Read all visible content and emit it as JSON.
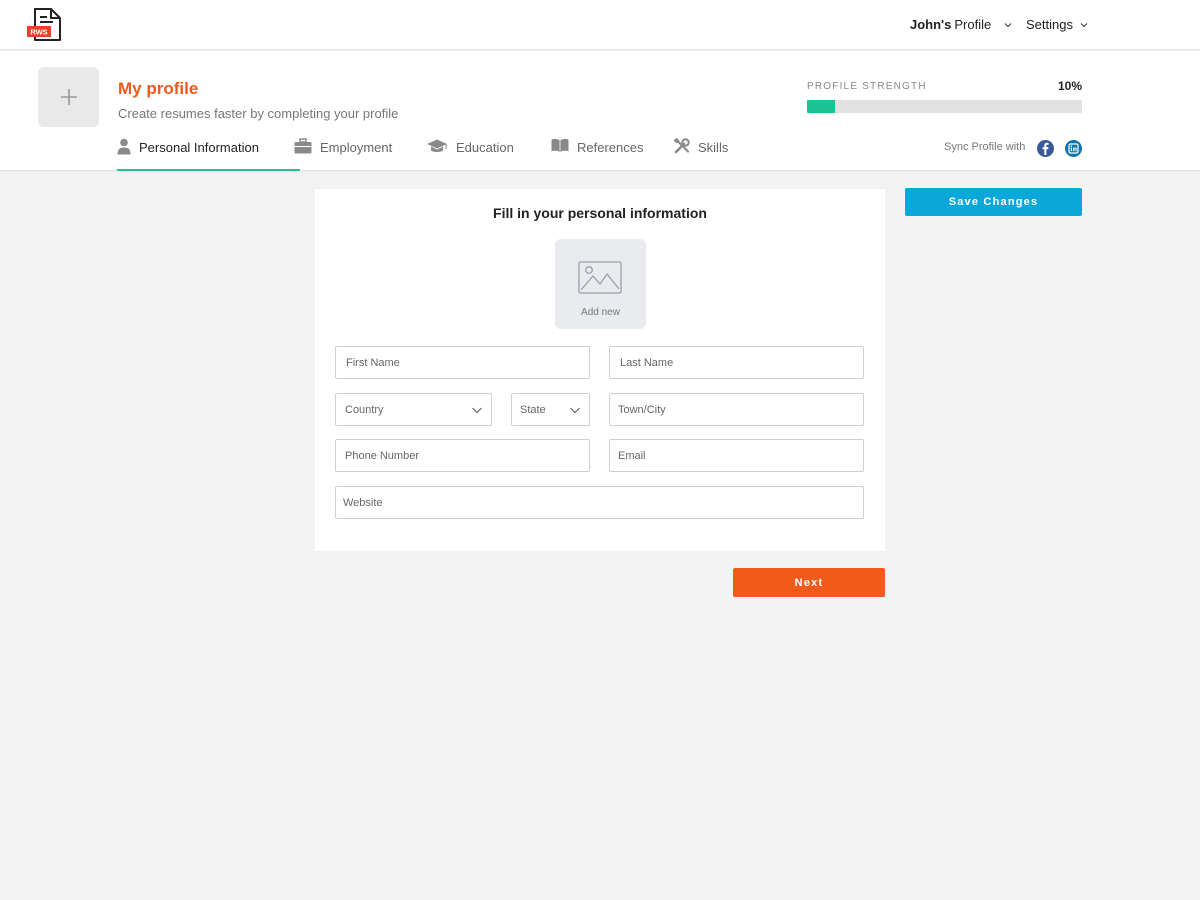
{
  "brand": {
    "logo_text": "RWS",
    "accent": "#ec5b1a",
    "brand_red": "#e8402a"
  },
  "topnav": {
    "profile_name": "John's",
    "profile_suffix": "Profile",
    "settings_label": "Settings"
  },
  "header": {
    "title": "My profile",
    "subtitle": "Create resumes faster by completing your profile",
    "strength_label": "PROFILE STRENGTH",
    "strength_value": "10%",
    "strength_fraction": 0.1,
    "strength_color": "#1cc395"
  },
  "tabs": [
    {
      "label": "Personal Information",
      "icon": "person-icon",
      "active": true
    },
    {
      "label": "Employment",
      "icon": "briefcase-icon",
      "active": false
    },
    {
      "label": "Education",
      "icon": "graduation-cap-icon",
      "active": false
    },
    {
      "label": "References",
      "icon": "book-icon",
      "active": false
    },
    {
      "label": "Skills",
      "icon": "tools-icon",
      "active": false
    }
  ],
  "sync": {
    "label": "Sync Profile with",
    "networks": [
      "facebook-icon",
      "linkedin-icon"
    ]
  },
  "form": {
    "title": "Fill in your personal information",
    "photo_label": "Add new",
    "fields": {
      "first_name": "First Name",
      "last_name": "Last Name",
      "country": "Country",
      "state": "State",
      "town": "Town/City",
      "phone": "Phone Number",
      "email": "Email",
      "website": "Website"
    }
  },
  "buttons": {
    "save": "Save Changes",
    "next": "Next",
    "save_color": "#0aa8d8",
    "next_color": "#f05a1a"
  }
}
